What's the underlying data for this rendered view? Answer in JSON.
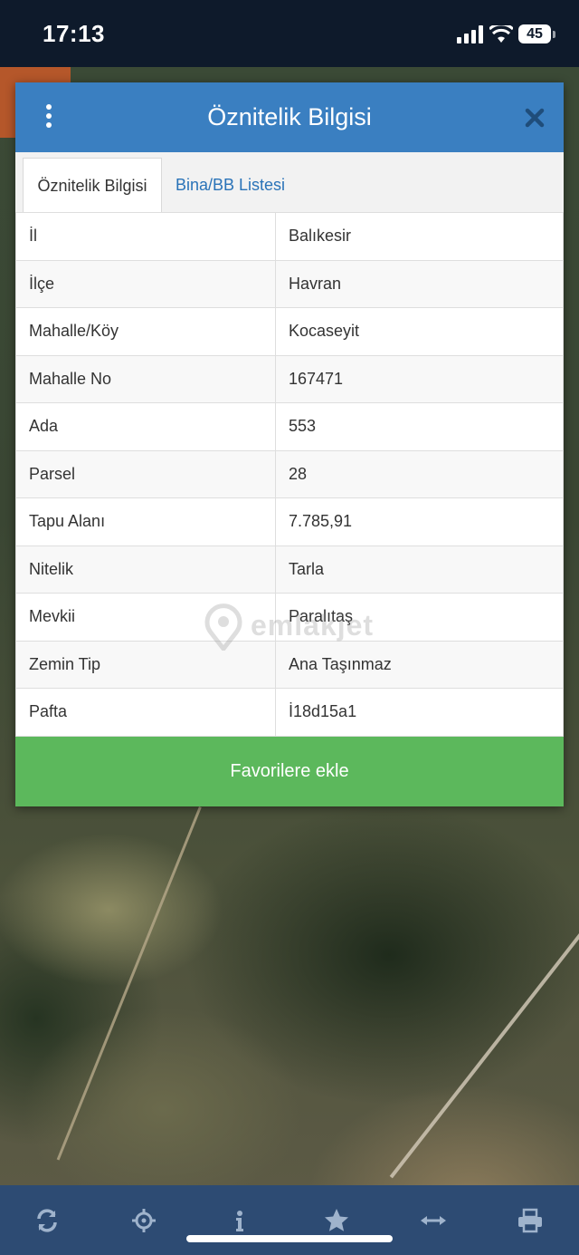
{
  "status_bar": {
    "time": "17:13",
    "battery": "45"
  },
  "dialog": {
    "title": "Öznitelik Bilgisi",
    "tabs": [
      {
        "label": "Öznitelik Bilgisi",
        "active": true
      },
      {
        "label": "Bina/BB Listesi",
        "active": false
      }
    ],
    "rows": [
      {
        "key": "İl",
        "value": "Balıkesir"
      },
      {
        "key": "İlçe",
        "value": "Havran"
      },
      {
        "key": "Mahalle/Köy",
        "value": "Kocaseyit"
      },
      {
        "key": "Mahalle No",
        "value": "167471"
      },
      {
        "key": "Ada",
        "value": "553"
      },
      {
        "key": "Parsel",
        "value": "28"
      },
      {
        "key": "Tapu Alanı",
        "value": "7.785,91"
      },
      {
        "key": "Nitelik",
        "value": "Tarla"
      },
      {
        "key": "Mevkii",
        "value": "Paralıtaş"
      },
      {
        "key": "Zemin Tip",
        "value": "Ana Taşınmaz"
      },
      {
        "key": "Pafta",
        "value": "İ18d15a1"
      }
    ],
    "favorite_button": "Favorilere ekle"
  },
  "watermark": "emlakjet",
  "toolbar": {
    "icons": [
      "refresh-icon",
      "locate-icon",
      "info-icon",
      "star-icon",
      "measure-icon",
      "print-icon"
    ]
  },
  "colors": {
    "header": "#3a7fc1",
    "favorite": "#5cb85c",
    "toolbar": "#2d4b73",
    "status_bar": "#0e1a2b"
  }
}
